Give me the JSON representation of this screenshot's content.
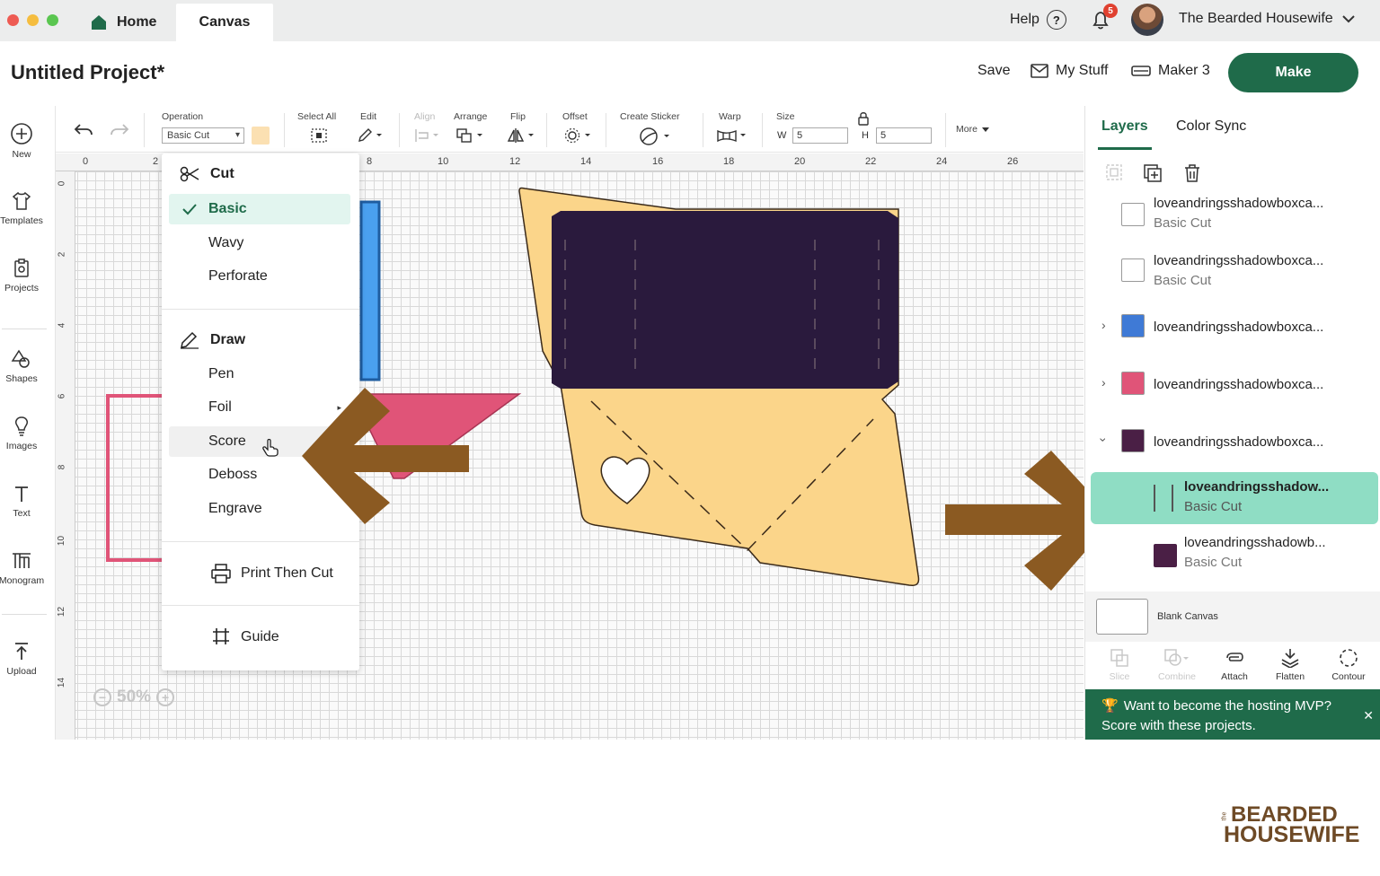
{
  "titlebar": {
    "tabs": [
      {
        "label": "Home"
      },
      {
        "label": "Canvas"
      }
    ],
    "help_label": "Help",
    "notification_count": "5",
    "user_name": "The Bearded Housewife"
  },
  "header": {
    "project_title": "Untitled Project*",
    "save_label": "Save",
    "mystuff_label": "My Stuff",
    "machine_label": "Maker 3",
    "make_label": "Make"
  },
  "leftnav": {
    "items": [
      {
        "label": "New",
        "icon": "plus-circle-icon"
      },
      {
        "label": "Templates",
        "icon": "shirt-icon"
      },
      {
        "label": "Projects",
        "icon": "projects-icon"
      },
      {
        "label": "Shapes",
        "icon": "shapes-icon"
      },
      {
        "label": "Images",
        "icon": "lightbulb-icon"
      },
      {
        "label": "Text",
        "icon": "text-icon"
      },
      {
        "label": "Monogram",
        "icon": "monogram-icon"
      },
      {
        "label": "Upload",
        "icon": "upload-icon"
      }
    ]
  },
  "toolbar": {
    "operation_label": "Operation",
    "operation_value": "Basic Cut",
    "select_all_label": "Select All",
    "edit_label": "Edit",
    "align_label": "Align",
    "arrange_label": "Arrange",
    "flip_label": "Flip",
    "offset_label": "Offset",
    "create_sticker_label": "Create Sticker",
    "warp_label": "Warp",
    "size_label": "Size",
    "w_label": "W",
    "w_value": "5",
    "h_label": "H",
    "h_value": "5",
    "more_label": "More"
  },
  "canvas": {
    "ruler_top": [
      "0",
      "2",
      "8",
      "10",
      "12",
      "14",
      "16",
      "18",
      "20",
      "22",
      "24",
      "26"
    ],
    "ruler_left": [
      "0",
      "2",
      "4",
      "6",
      "8",
      "10",
      "12",
      "14"
    ],
    "zoom_value": "50%"
  },
  "operation_menu": {
    "cut_head": "Cut",
    "cut_items": [
      "Basic",
      "Wavy",
      "Perforate"
    ],
    "draw_head": "Draw",
    "draw_items": [
      "Pen",
      "Foil",
      "Score",
      "Deboss",
      "Engrave"
    ],
    "print_then_cut": "Print Then Cut",
    "guide": "Guide"
  },
  "right_panel": {
    "tabs": [
      {
        "label": "Layers"
      },
      {
        "label": "Color Sync"
      }
    ],
    "layers": [
      {
        "name": "loveandringsshadowboxca...",
        "sub": "Basic Cut"
      },
      {
        "name": "loveandringsshadowboxca...",
        "sub": "Basic Cut"
      },
      {
        "name": "loveandringsshadowboxca...",
        "sub": ""
      },
      {
        "name": "loveandringsshadowboxca...",
        "sub": ""
      },
      {
        "name": "loveandringsshadowboxca...",
        "sub": ""
      },
      {
        "name": "loveandringsshadow...",
        "sub": "Basic Cut"
      },
      {
        "name": "loveandringsshadowb...",
        "sub": "Basic Cut"
      }
    ],
    "blank_canvas_label": "Blank Canvas",
    "tools": [
      "Slice",
      "Combine",
      "Attach",
      "Flatten",
      "Contour"
    ],
    "promo_line1": "Want to become the hosting MVP?",
    "promo_line2": "Score with these projects.",
    "colors": {
      "accent": "#1f6b4a",
      "selected_layer": "#8fddc4",
      "arrow": "#8b5a22",
      "envelope_fill": "#fbd58a",
      "envelope_band": "#2a1a3d",
      "pink_shape": "#e05478"
    }
  },
  "watermark": {
    "the": "the",
    "line1": "BEARDED",
    "line2": "HOUSEWIFE"
  }
}
